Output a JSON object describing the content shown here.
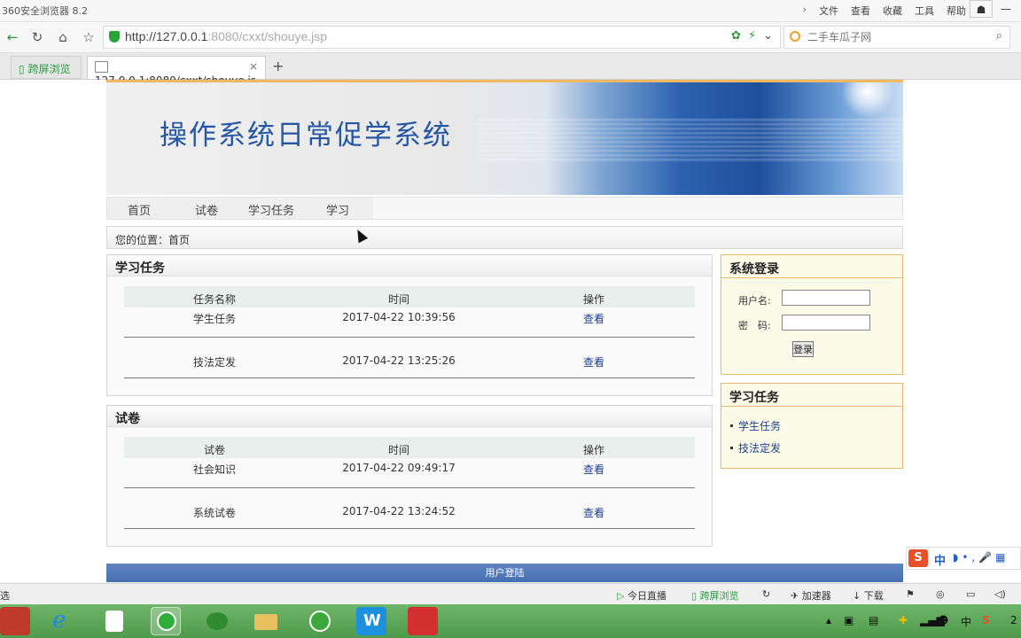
{
  "browser": {
    "app_title": "360安全浏览器 8.2",
    "menu": [
      "文件",
      "查看",
      "收藏",
      "工具",
      "帮助"
    ],
    "url_host": "http://127.0.0.1",
    "url_rest": ":8080/cxxt/shouye.jsp",
    "search_placeholder": "二手车瓜子网",
    "tabs": [
      {
        "label": "跨屏浏览"
      },
      {
        "label": "127.0.0.1:8080/cxxt/shouye.js"
      }
    ],
    "new_tab": "+",
    "close_tab": "×"
  },
  "site": {
    "title": "操作系统日常促学系统",
    "nav": [
      "首页",
      "试卷",
      "学习任务",
      "学习"
    ],
    "breadcrumb": "您的位置：首页"
  },
  "tasks_panel": {
    "title": "学习任务",
    "columns": [
      "任务名称",
      "时间",
      "操作"
    ],
    "rows": [
      {
        "name": "学生任务",
        "time": "2017-04-22 10:39:56",
        "action": "查看"
      },
      {
        "name": "技法定发",
        "time": "2017-04-22 13:25:26",
        "action": "查看"
      }
    ]
  },
  "papers_panel": {
    "title": "试卷",
    "columns": [
      "试卷",
      "时间",
      "操作"
    ],
    "rows": [
      {
        "name": "社会知识",
        "time": "2017-04-22 09:49:17",
        "action": "查看"
      },
      {
        "name": "系统试卷",
        "time": "2017-04-22 13:24:52",
        "action": "查看"
      }
    ]
  },
  "login": {
    "title": "系统登录",
    "username_label": "用户名:",
    "password_label": "密　码:",
    "button": "登录"
  },
  "side_tasks": {
    "title": "学习任务",
    "items": [
      "学生任务",
      "技法定发"
    ]
  },
  "footer": {
    "label": "用户登陆"
  },
  "ime": {
    "logo": "S",
    "mode": "中",
    "rest": "◗•,🎤▦"
  },
  "statusbar": {
    "left": "选",
    "items": [
      "今日直播",
      "跨屏浏览",
      "加速器",
      "下载"
    ]
  },
  "tray": {
    "ime": "中",
    "clock": "2"
  }
}
